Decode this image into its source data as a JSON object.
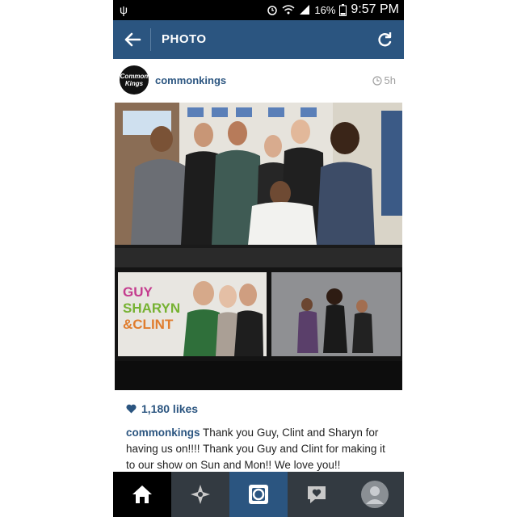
{
  "status_bar": {
    "usb_icon": "usb-icon",
    "battery_percent": "16%",
    "time": "9:57 PM"
  },
  "app_bar": {
    "title": "PHOTO",
    "back_icon": "back-arrow-icon",
    "refresh_icon": "refresh-icon"
  },
  "post": {
    "avatar_text": "Common Kings",
    "username": "commonkings",
    "time_ago": "5h",
    "photo_top_signage": [
      "GUY",
      "SHARYN",
      "&CLINT"
    ],
    "likes": "1,180 likes",
    "caption_user": "commonkings",
    "caption_text": "Thank you Guy, Clint and Sharyn for having us on!!!! Thank you Guy and Clint for making it to our show on Sun and Mon!! We love you!!"
  },
  "bottom_nav": {
    "items": [
      "home-icon",
      "explore-icon",
      "camera-icon",
      "activity-icon",
      "profile-icon"
    ]
  },
  "colors": {
    "accent": "#2b5580",
    "nav_bg": "#333a41"
  }
}
